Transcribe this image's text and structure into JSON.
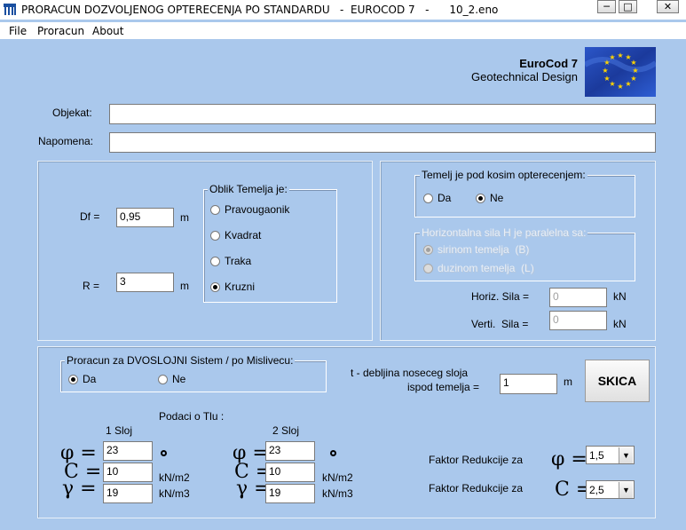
{
  "window": {
    "title": "PRORACUN DOZVOLJENOG OPTERECENJA PO STANDARDU   -  EUROCOD 7   -      10_2.eno",
    "minimize": "─",
    "maximize": "□",
    "close": "✕"
  },
  "menu": [
    "File",
    "Proracun",
    "About"
  ],
  "brand": {
    "line1": "EuroCod 7",
    "line2": "Geotechnical Design",
    "flag_color": "#1f3fa0",
    "star_color": "#ffd400"
  },
  "objekat": {
    "label": "Objekat:",
    "value": ""
  },
  "napomena": {
    "label": "Napomena:",
    "value": ""
  },
  "left_panel": {
    "df_label": "Df =",
    "df_value": "0,95",
    "df_unit": "m",
    "r_label": "R =",
    "r_value": "3",
    "r_unit": "m",
    "oblik": {
      "caption": "Oblik Temelja je:",
      "options": [
        "Pravougaonik",
        "Kvadrat",
        "Traka",
        "Kruzni"
      ],
      "selected": "Kruzni"
    }
  },
  "right_panel": {
    "kosi": {
      "caption": "Temelj je pod kosim opterecenjem:",
      "da": "Da",
      "ne": "Ne",
      "selected": "Ne"
    },
    "horiz": {
      "caption": "Horizontalna sila H je paralelna sa:",
      "opt1": "sirinom temelja  (B)",
      "opt2": "duzinom temelja  (L)",
      "selected": "opt1"
    },
    "hsila_label": "Horiz. Sila =",
    "hsila_value": "0",
    "hsila_unit": "kN",
    "vsila_label": "Verti.  Sila =",
    "vsila_value": "0",
    "vsila_unit": "kN"
  },
  "bottom_panel": {
    "dvosloj": {
      "caption": "Proracun za DVOSLOJNI Sistem / po Mislivecu:",
      "da": "Da",
      "ne": "Ne",
      "selected": "Da"
    },
    "t_label1": "t - debljina noseceg sloja",
    "t_label2": "ispod temelja =",
    "t_value": "1",
    "t_unit": "m",
    "skica": "SKICA",
    "podaci": "Podaci o Tlu :",
    "sloj1": {
      "title": "1 Sloj",
      "phi": "23",
      "c": "10",
      "gamma": "19"
    },
    "sloj2": {
      "title": "2 Sloj",
      "phi": "23",
      "c": "10",
      "gamma": "19"
    },
    "sym_phi": "φ =",
    "sym_c": "C =",
    "sym_gamma": "γ =",
    "unit_c": "kN/m2",
    "unit_gamma": "kN/m3",
    "faktor_label": "Faktor Redukcije za",
    "faktor_phi_sym": "φ =",
    "faktor_phi_value": "1,5",
    "faktor_c_sym": "C =",
    "faktor_c_value": "2,5",
    "dropdown_arrow": "▼"
  }
}
